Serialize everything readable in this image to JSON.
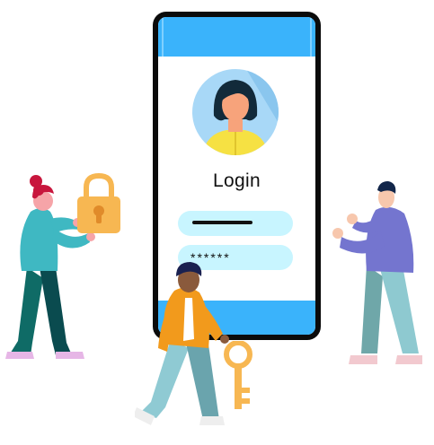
{
  "login": {
    "title": "Login",
    "username_placeholder": "",
    "password_value": "******"
  },
  "icons": [
    "padlock-icon",
    "key-icon",
    "user-avatar"
  ],
  "colors": {
    "screen_bar": "#3ab3fb",
    "field_fill": "#c8f5ff",
    "padlock": "#f7b752",
    "key": "#f7b752"
  }
}
